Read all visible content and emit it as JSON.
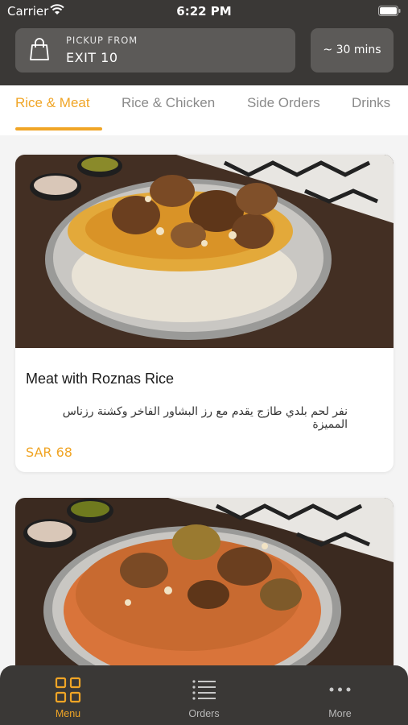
{
  "status_bar": {
    "carrier": "Carrier",
    "time": "6:22 PM"
  },
  "header": {
    "pickup_label": "PICKUP FROM",
    "pickup_location": "EXIT 10",
    "eta": "~ 30 mins"
  },
  "tabs": [
    {
      "label": "Rice & Meat",
      "active": true
    },
    {
      "label": "Rice & Chicken",
      "active": false
    },
    {
      "label": "Side Orders",
      "active": false
    },
    {
      "label": "Drinks",
      "active": false
    }
  ],
  "items": [
    {
      "title": "Meat with Roznas Rice",
      "description": "نفر لحم بلدي طازج يقدم مع رز البشاور الفاخر وكشنة رزناس المميزة",
      "price": "SAR 68"
    },
    {
      "title": "",
      "description": "",
      "price": ""
    }
  ],
  "bottom_nav": [
    {
      "label": "Menu",
      "icon": "grid-icon",
      "active": true
    },
    {
      "label": "Orders",
      "icon": "list-icon",
      "active": false
    },
    {
      "label": "More",
      "icon": "more-icon",
      "active": false
    }
  ],
  "colors": {
    "accent": "#f0a526",
    "header_bg": "#3a3836",
    "pill_bg": "#5c5a58"
  }
}
